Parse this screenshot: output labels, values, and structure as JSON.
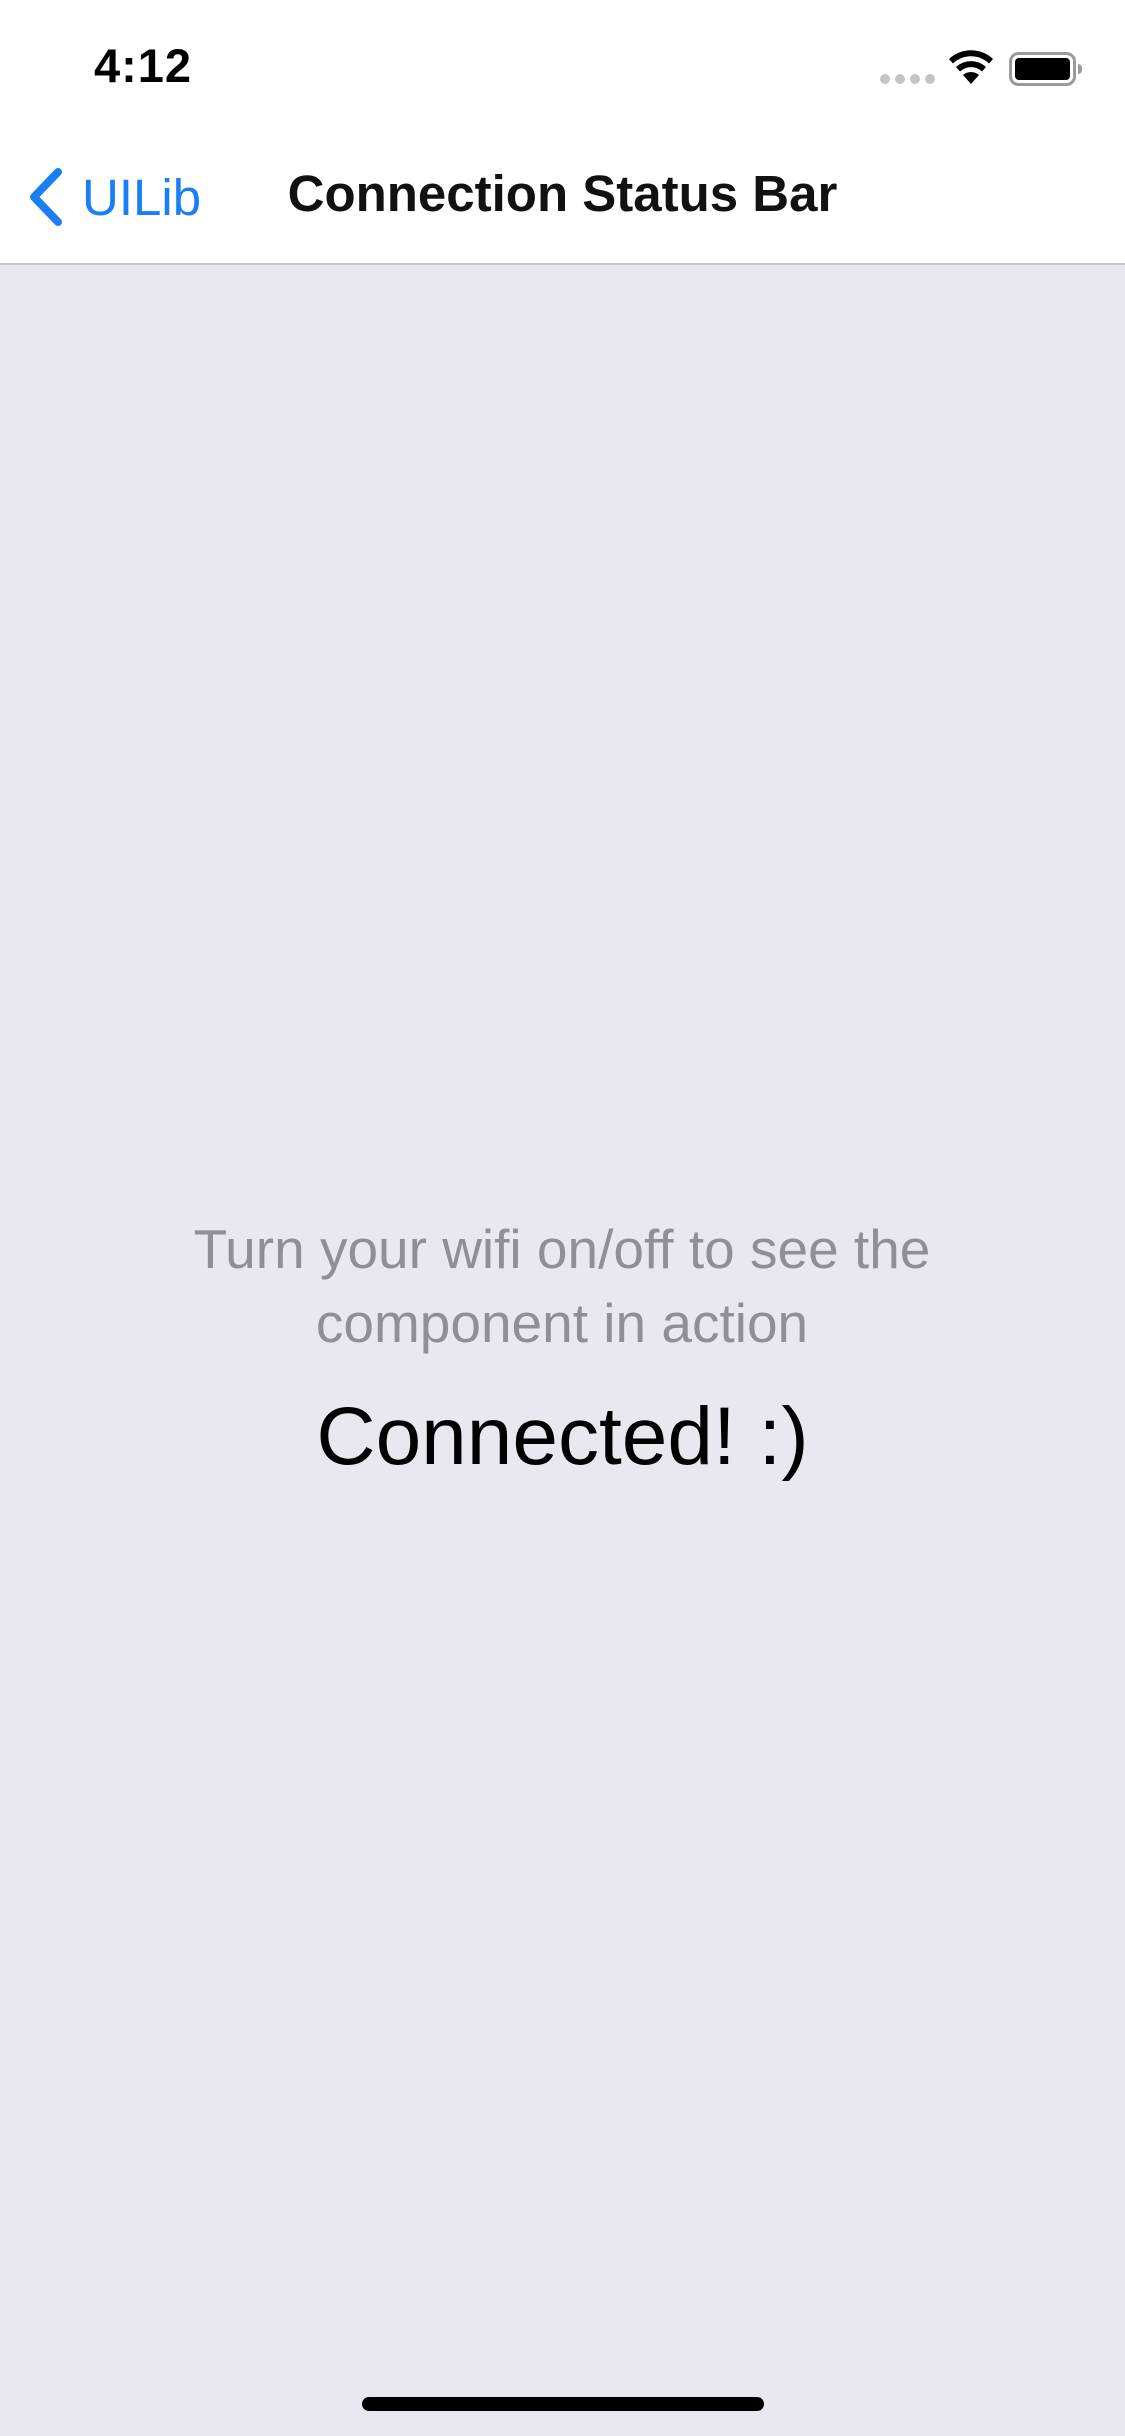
{
  "status_bar": {
    "time": "4:12",
    "icons": [
      "cellular-signal-icon",
      "wifi-icon",
      "battery-icon"
    ]
  },
  "nav_bar": {
    "back_label": "UILib",
    "title": "Connection Status Bar",
    "accent_color": "#1a7ff2"
  },
  "content": {
    "hint": "Turn your wifi on/off to see the component in action",
    "connection_status": "Connected! :)"
  },
  "colors": {
    "background": "#e9e8ee",
    "hint_text": "#8e9094"
  }
}
